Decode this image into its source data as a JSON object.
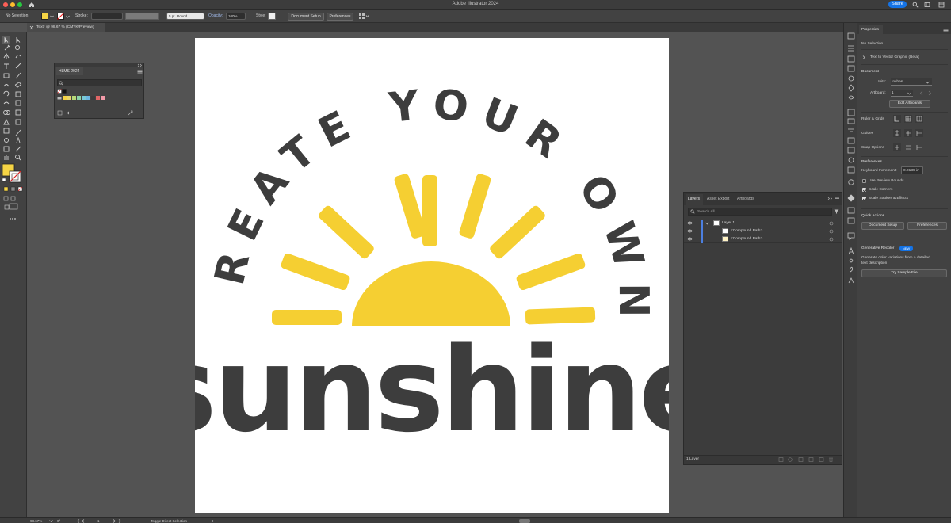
{
  "window": {
    "title": "Adobe Illustrator 2024",
    "share_label": "Share"
  },
  "control_bar": {
    "selection": "No Selection",
    "stroke_label": "Stroke:",
    "brush": "5 pt. Round",
    "opacity_label": "Opacity:",
    "opacity_value": "100%",
    "style_label": "Style:",
    "document_setup": "Document Setup",
    "preferences": "Preferences"
  },
  "document_tab": {
    "label": "Text* @ 98.67 % (CMYK/Preview)"
  },
  "swatches_panel": {
    "title": "HLMS 2024",
    "colors": [
      "#f5d445",
      "#e8d66c",
      "#b7d979",
      "#8cd3a8",
      "#79c9d6",
      "#6cb5e2",
      "#3b3b3b",
      "#e06666",
      "#f29aa8"
    ]
  },
  "artwork": {
    "arc_text": "CREATE YOUR OWN",
    "main_text": "sunshine",
    "sun_color": "#f5cf32",
    "text_color": "#3d3d3d"
  },
  "layers_panel": {
    "tabs": [
      "Layers",
      "Asset Export",
      "Artboards"
    ],
    "search_placeholder": "Search All",
    "layer_name": "Layer 1",
    "children": [
      "<Compound Path>",
      "<Compound Path>"
    ],
    "footer": "1 Layer"
  },
  "properties": {
    "tab": "Properties",
    "selection": "No Selection",
    "text_to_vector": "Text to Vector Graphic (Beta)",
    "document_heading": "Document",
    "units_label": "Units:",
    "units_value": "Inches",
    "artboard_label": "Artboard:",
    "artboard_value": "1",
    "edit_artboards": "Edit Artboards",
    "rulers_grids": "Ruler & Grids",
    "guides": "Guides",
    "snap_options": "Snap Options",
    "preferences_heading": "Preferences",
    "keyboard_increment_label": "Keyboard Increment:",
    "keyboard_increment_value": "0.0139 in",
    "use_preview_bounds": "Use Preview Bounds",
    "scale_corners": "Scale Corners",
    "scale_strokes": "Scale Strokes & Effects",
    "checkboxes": {
      "use_preview_bounds": false,
      "scale_corners": true,
      "scale_strokes": true
    },
    "quick_actions_heading": "Quick Actions",
    "document_setup": "Document Setup",
    "preferences_btn": "Preferences",
    "gen_recolor_heading": "Generative Recolor",
    "new_badge": "NEW",
    "gen_recolor_desc1": "Generate color variations from a detailed",
    "gen_recolor_desc2": "text description",
    "try_sample": "Try Sample File"
  },
  "status_bar": {
    "zoom": "98.67%",
    "rotation": "0°",
    "artboard": "1",
    "tool": "Toggle Direct Selection"
  }
}
